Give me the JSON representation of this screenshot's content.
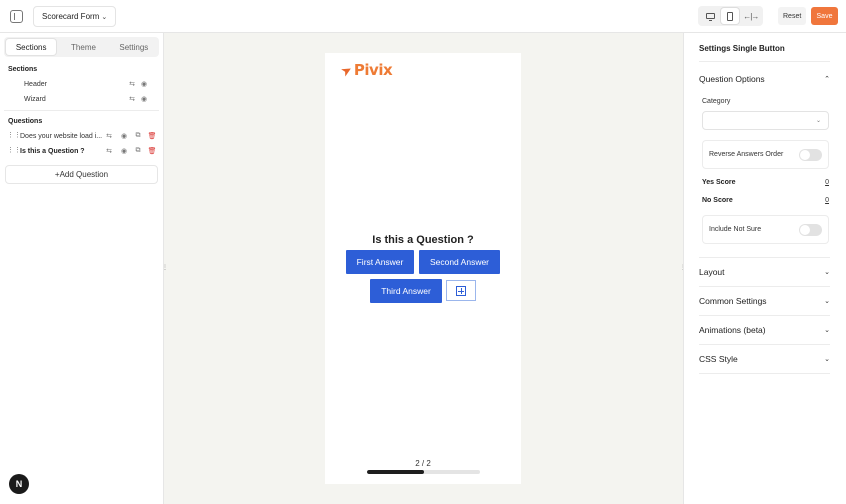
{
  "topbar": {
    "form_name": "Scorecard Form",
    "reset_label": "Reset",
    "save_label": "Save",
    "accent_color": "#f0763c",
    "active_device": "mobile"
  },
  "left_panel": {
    "tabs": [
      {
        "label": "Sections",
        "active": true
      },
      {
        "label": "Theme",
        "active": false
      },
      {
        "label": "Settings",
        "active": false
      }
    ],
    "sections_title": "Sections",
    "sections": [
      {
        "label": "Header"
      },
      {
        "label": "Wizard"
      }
    ],
    "questions_title": "Questions",
    "questions": [
      {
        "label": "Does your website load i...",
        "selected": false
      },
      {
        "label": "Is this a Question ?",
        "selected": true
      }
    ],
    "add_question_label": "Add Question"
  },
  "canvas": {
    "logo_text": "Pivix",
    "question_title": "Is this a Question ?",
    "answers": [
      "First Answer",
      "Second Answer",
      "Third Answer"
    ],
    "answer_color": "#2d5ed7",
    "progress_text": "2 / 2",
    "progress_fraction": 0.5
  },
  "right_panel": {
    "title": "Settings Single Button",
    "question_options_label": "Question Options",
    "category_label": "Category",
    "category_value": "",
    "reverse_answers_label": "Reverse Answers Order",
    "reverse_answers_on": false,
    "yes_score_label": "Yes Score",
    "yes_score_value": "0",
    "no_score_label": "No Score",
    "no_score_value": "0",
    "include_not_sure_label": "Include Not Sure",
    "include_not_sure_on": false,
    "sections": [
      {
        "label": "Layout"
      },
      {
        "label": "Common Settings"
      },
      {
        "label": "Animations (beta)"
      },
      {
        "label": "CSS Style"
      }
    ]
  },
  "badge": {
    "letter": "N"
  }
}
